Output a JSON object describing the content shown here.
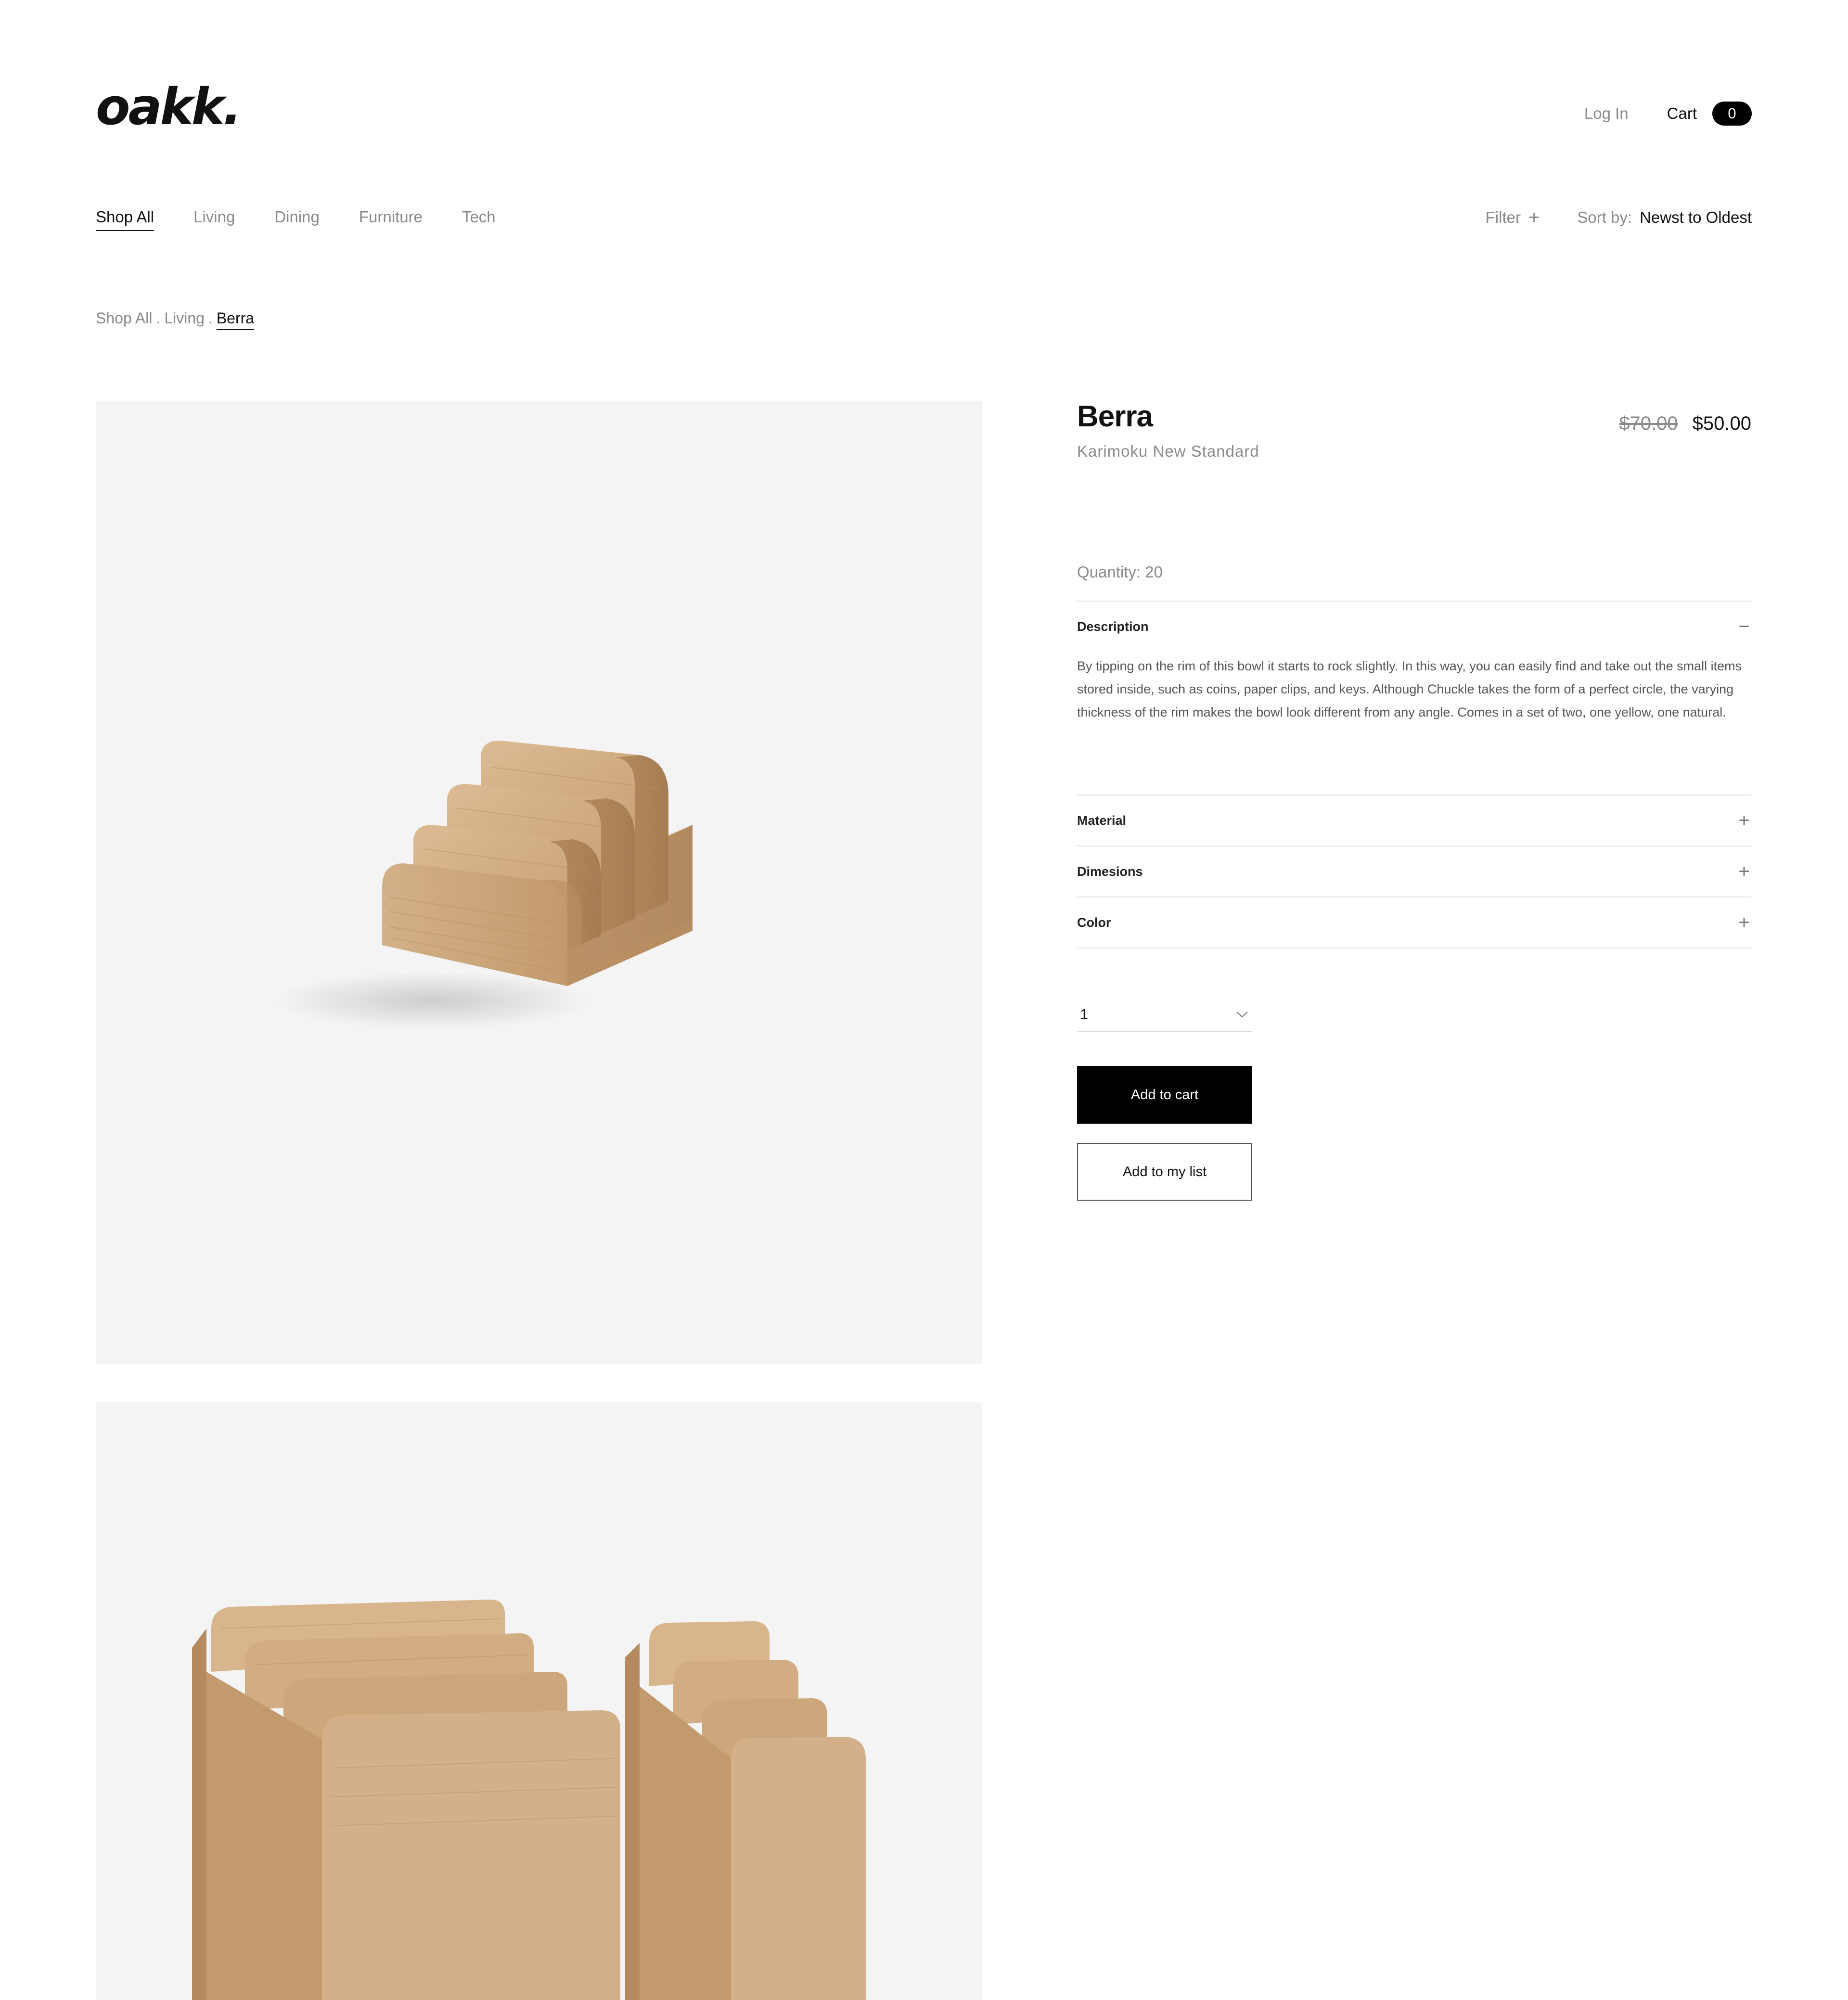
{
  "header": {
    "logo": "oakk.",
    "login_label": "Log In",
    "cart_label": "Cart",
    "cart_count": "0"
  },
  "categories": [
    {
      "label": "Shop All",
      "active": true
    },
    {
      "label": "Living"
    },
    {
      "label": "Dining"
    },
    {
      "label": "Furniture"
    },
    {
      "label": "Tech"
    }
  ],
  "toolbar": {
    "filter_label": "Filter",
    "filter_icon": "plus-icon",
    "sort_label": "Sort by:",
    "sort_value": "Newst to Oldest"
  },
  "breadcrumb": {
    "items": [
      "Shop All",
      "Living"
    ],
    "separator": ".",
    "current": "Berra"
  },
  "product": {
    "name": "Berra",
    "brand": "Karimoku New Standard",
    "old_price": "$70.00",
    "price": "$50.00",
    "quantity_label": "Quantity: 20",
    "description_title": "Description",
    "description": "By tipping on the rim of this bowl it starts to rock slightly. In this way, you can easily find and take out the small items stored inside, such as coins, paper clips, and keys. Although Chuckle takes the form of a perfect circle, the varying thickness of the rim makes the bowl look different from any angle. Comes in a set of two, one yellow, one natural.",
    "accordions": [
      {
        "label": "Material",
        "icon": "plus-icon"
      },
      {
        "label": "Dimesions",
        "icon": "plus-icon"
      },
      {
        "label": "Color",
        "icon": "plus-icon"
      }
    ],
    "qty_selected": "1",
    "add_to_cart": "Add to cart",
    "add_to_list": "Add to my list"
  },
  "colors": {
    "accent": "#000000",
    "muted_text": "#8a8a8a",
    "image_bg": "#f4f4f4",
    "wood": "#c9a47c"
  }
}
